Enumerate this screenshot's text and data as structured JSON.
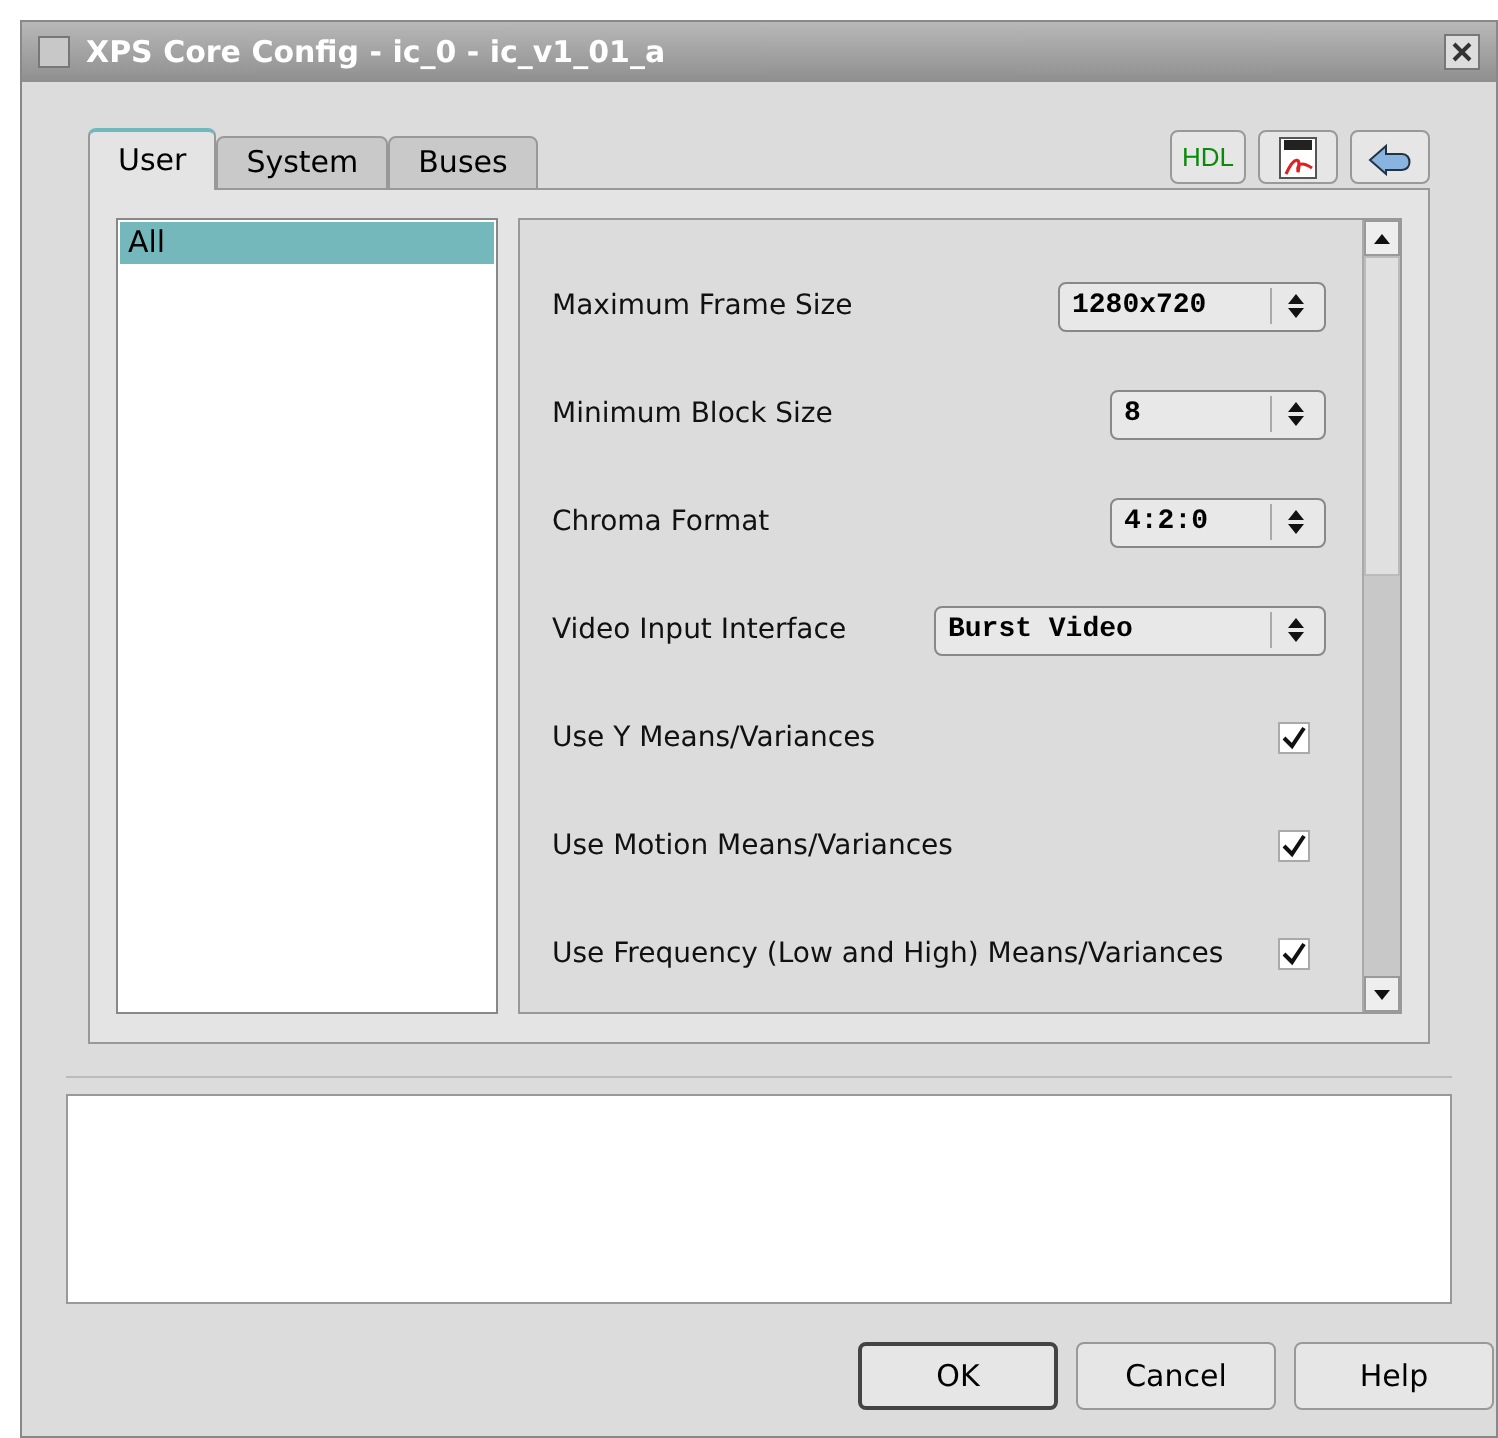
{
  "window": {
    "title": "XPS Core Config - ic_0 - ic_v1_01_a"
  },
  "tabs": [
    {
      "label": "User",
      "selected": true
    },
    {
      "label": "System",
      "selected": false
    },
    {
      "label": "Buses",
      "selected": false
    }
  ],
  "toolbar": {
    "hdl_label": "HDL"
  },
  "category_list": [
    {
      "label": "All",
      "selected": true
    }
  ],
  "parameters": [
    {
      "kind": "select",
      "label": "Maximum Frame Size",
      "value": "1280x720"
    },
    {
      "kind": "select",
      "label": "Minimum Block Size",
      "value": "8"
    },
    {
      "kind": "select",
      "label": "Chroma Format",
      "value": "4:2:0"
    },
    {
      "kind": "select",
      "label": "Video Input Interface",
      "value": "Burst Video"
    },
    {
      "kind": "checkbox",
      "label": "Use Y Means/Variances",
      "checked": true
    },
    {
      "kind": "checkbox",
      "label": "Use Motion Means/Variances",
      "checked": true
    },
    {
      "kind": "checkbox",
      "label": "Use Frequency (Low and High) Means/Variances",
      "checked": true
    }
  ],
  "buttons": [
    {
      "label": "OK",
      "default": true
    },
    {
      "label": "Cancel",
      "default": false
    },
    {
      "label": "Help",
      "default": false
    }
  ]
}
